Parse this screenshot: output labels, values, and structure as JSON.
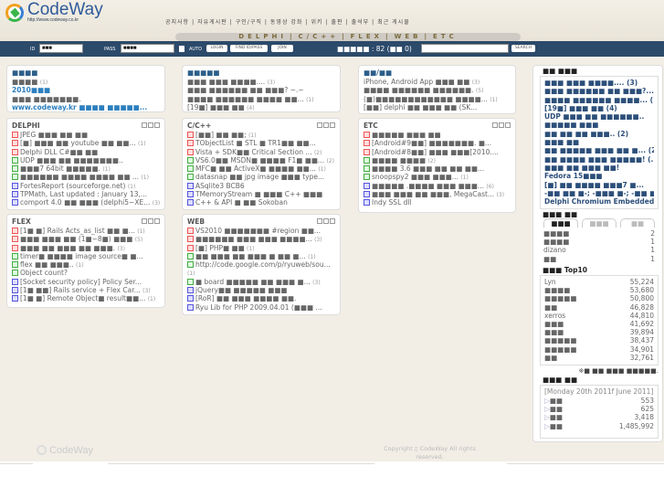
{
  "header": {
    "logo_name": "CodeWay",
    "logo_url": "http://www.codeway.co.kr",
    "menu": [
      "공지사항",
      "자유게시판",
      "구인/구직",
      "동영상 강좌",
      "위키",
      "출판",
      "출석부",
      "최근 게시물"
    ],
    "categories": [
      "DELPHI",
      "C/C++",
      "FLEX",
      "WEB",
      "ETC"
    ]
  },
  "login": {
    "id_label": "ID",
    "id_value": "■■■",
    "pass_label": "PASS",
    "pass_value": "■■■■",
    "auto_label": "AUTO",
    "login_btn": "LOGIN",
    "find_btn": "FIND ID/PASS",
    "join_btn": "JOIN",
    "online_text": "■■■■■ : 82 (■■ 0)",
    "search_btn": "SEARCH",
    "search_value": ""
  },
  "panels": {
    "notice": {
      "title": "■■■■",
      "rows": [
        {
          "t": "■■■■",
          "c": "(1)"
        },
        {
          "t": "2010■■■",
          "c": "",
          "link": true
        },
        {
          "t": "■■■ ■■■■■■■.",
          "c": ""
        },
        {
          "t": "www.codeway.kr ■■■■ ■■■■■...",
          "c": "",
          "link": true
        }
      ]
    },
    "free": {
      "title": "■■■■■",
      "rows": [
        {
          "t": "■■■ ■■■ ■■■■....",
          "c": "(3)"
        },
        {
          "t": "■■■ ■■■■■■ ■■ ■■■? ~.~",
          "c": ""
        },
        {
          "t": "■■■■ ■■■■■■ ■■■■ ■■...",
          "c": "(1)"
        },
        {
          "t": "[19■] ■■■ ■■",
          "c": "(4)"
        }
      ]
    },
    "jobs": {
      "title": "■■/■■",
      "rows": [
        {
          "t": "iPhone, Android App ■■■ ■■",
          "c": "(3)"
        },
        {
          "t": "■■■■ ■■■■■■ ■■■■■■.",
          "c": "(5)"
        },
        {
          "t": "(■)■■■■■■■■■■■■ ■■■■...",
          "c": "(1)"
        },
        {
          "t": "[■■] delphi ■■ ■■■ ■■ (SK...",
          "c": ""
        }
      ]
    },
    "delphi": {
      "title": "DELPHI",
      "rows": [
        {
          "i": "r",
          "t": "JPEG ■■■ ■■ ■■",
          "c": ""
        },
        {
          "i": "r",
          "t": "[■] ■■■ ■■ youtube ■■ ■■...",
          "c": "(1)"
        },
        {
          "i": "r",
          "t": "Delphi DLL C#■■ ■■",
          "c": ""
        },
        {
          "i": "g",
          "t": "UDP ■■■ ■■ ■■■■■■■..",
          "c": ""
        },
        {
          "i": "g",
          "t": "■■■7 64bit ■■■■■.",
          "c": "(1)"
        },
        {
          "i": "g",
          "t": "■■■■■■ ■■■■ ■■■■ ■■ ...",
          "c": "(1)"
        },
        {
          "i": "b",
          "t": "FortesReport (sourceforge.net)",
          "c": "(1)"
        },
        {
          "i": "b",
          "t": "TPMath, Last updated : January 13,...",
          "c": ""
        },
        {
          "i": "b",
          "t": "comport 4.0 ■■ ■■■ (delphi5~XE...",
          "c": "(3)"
        }
      ]
    },
    "cpp": {
      "title": "C/C++",
      "rows": [
        {
          "i": "r",
          "t": "[■■] ■■ ■■;",
          "c": "(1)"
        },
        {
          "i": "r",
          "t": "TObjectList ■ STL ■ TR1■■ ■■...",
          "c": ""
        },
        {
          "i": "r",
          "t": "Vista + SDK■■ Critical Section ...",
          "c": "(2)"
        },
        {
          "i": "g",
          "t": "VS6.0■■ MSDN■ ■■■■ F1■ ■■...",
          "c": "(2)"
        },
        {
          "i": "g",
          "t": "MFC■ ■■ ActiveX■ ■■■■ ■■...",
          "c": "(1)"
        },
        {
          "i": "g",
          "t": "datasnap ■■ jpg image ■■■ type...",
          "c": ""
        },
        {
          "i": "b",
          "t": "ASqlite3 BCB6",
          "c": ""
        },
        {
          "i": "b",
          "t": "TMemoryStream ■ ■■■ C++ ■■■",
          "c": ""
        },
        {
          "i": "b",
          "t": "C++ & API ■ ■■ Sokoban",
          "c": ""
        }
      ]
    },
    "etc": {
      "title": "ETC",
      "rows": [
        {
          "i": "r",
          "t": "■■■■■ ■■■ ■■",
          "c": ""
        },
        {
          "i": "r",
          "t": "[Android#9■■] ■■■■■■■. ■...",
          "c": ""
        },
        {
          "i": "r",
          "t": "[Android#8■■] ■■■ ■■■[2010....",
          "c": ""
        },
        {
          "i": "g",
          "t": "■■■■ ■■■■",
          "c": "(2)"
        },
        {
          "i": "g",
          "t": "■■■■ 3.6 ■■■ ■■ ■■ ■■...",
          "c": ""
        },
        {
          "i": "g",
          "t": "snoopspy2 ■■■ ■■■...",
          "c": "(1)"
        },
        {
          "i": "b",
          "t": "■■■■■ .■■■■ ■■■ ■■■...",
          "c": "(6)"
        },
        {
          "i": "b",
          "t": "■■■ ■■■ ■■ ■■■, MegaCast...",
          "c": "(3)"
        },
        {
          "i": "b",
          "t": "Indy SSL dll",
          "c": ""
        }
      ]
    },
    "flex": {
      "title": "FLEX",
      "rows": [
        {
          "i": "r",
          "t": "[1■ ■] Rails Acts_as_list ■■ ■...",
          "c": "(1)"
        },
        {
          "i": "r",
          "t": "■■■ ■■■ ■■ (1■~8■) ■■■",
          "c": "(5)"
        },
        {
          "i": "r",
          "t": "■■■ ■■ ■■■ ■■ ■■■.",
          "c": "(3)"
        },
        {
          "i": "g",
          "t": "timer■ ■■■■ image source■ ■...",
          "c": ""
        },
        {
          "i": "g",
          "t": "flex ■■ ■■■..",
          "c": "(1)"
        },
        {
          "i": "g",
          "t": "Object count?",
          "c": ""
        },
        {
          "i": "b",
          "t": "[Socket security policy] Policy Ser...",
          "c": ""
        },
        {
          "i": "b",
          "t": "[1■ ■■] Rails service + Flex Car...",
          "c": "(3)"
        },
        {
          "i": "b",
          "t": "[1■ ■] Remote Object■ result■■...",
          "c": "(1)"
        }
      ]
    },
    "web": {
      "title": "WEB",
      "rows": [
        {
          "i": "r",
          "t": "VS2010 ■■■■■■■ #region ■■...",
          "c": ""
        },
        {
          "i": "r",
          "t": "■■■■■■ ■■■ ■■■ ■■■■...",
          "c": "(3)"
        },
        {
          "i": "r",
          "t": "[■] PHP■ ■■",
          "c": "(1)"
        },
        {
          "i": "g",
          "t": "■■ ■■■ ■■ ■■■ ■ ■■ ■...",
          "c": "(1)"
        },
        {
          "i": "g",
          "t": "http://code.google.com/p/ryuweb/sou...",
          "c": ""
        },
        {
          "t": "",
          "c": "(1)"
        },
        {
          "i": "g",
          "t": "■ board ■■■■■ ■■ ■■■ ■...",
          "c": "(3)"
        },
        {
          "i": "b",
          "t": "jQuery■■ ■■■■■ ■■■",
          "c": ""
        },
        {
          "i": "b",
          "t": "[RoR] ■■ ■■■ ■■■■ ■■.",
          "c": ""
        },
        {
          "i": "b",
          "t": "Ryu Lib for PHP 2009.04.01 (■■■ ...",
          "c": ""
        }
      ]
    }
  },
  "sidebar": {
    "recent_title": "■■ ■■■",
    "recent": [
      "■■■ ■■■ ■■■■.... (3)",
      "■■■ ■■■■■■ ■■ ■■■?...",
      "■■■■ ■■■■■■ ■■■■... (1)",
      "[19■] ■■■ ■■ (4)",
      "UDP ■■■ ■■ ■■■■■■..",
      "■■■■■ ■■■",
      "■■ ■■ ■■ ■■■.. (2)",
      "■■■ ■■",
      "■■ ■■■■■ ■■■ ■■ ■... (2)",
      "■■ ■■■■ ■■■ ■■■■■! (...",
      "■■■ ■■ ■■■ ■■!",
      "Fedora 15■■■",
      "[■] ■■ ■■■■ ■■■7 ■...",
      "-■■ ■■ ■-; -■■■ ■-; -■■ ■..",
      "Delphi Chromium Embedded"
    ],
    "members_title": "■■■ ■■",
    "tabs": [
      "■■■",
      "■■■",
      "■■"
    ],
    "members": [
      {
        "k": "■■■■",
        "v": "2"
      },
      {
        "k": "■■■■",
        "v": "1"
      },
      {
        "k": "dizano",
        "v": "1"
      },
      {
        "k": "■■",
        "v": "1"
      }
    ],
    "top_title": "■■■ Top10",
    "top": [
      {
        "k": "Lyn",
        "v": "55,224"
      },
      {
        "k": "■■■■",
        "v": "53,680"
      },
      {
        "k": "■■■■■",
        "v": "50,800"
      },
      {
        "k": "■■",
        "v": "46,828"
      },
      {
        "k": "xerros",
        "v": "44,810"
      },
      {
        "k": "■■■",
        "v": "41,692"
      },
      {
        "k": "■■■",
        "v": "39,894"
      },
      {
        "k": "■■■■■",
        "v": "38,437"
      },
      {
        "k": "■■■■■",
        "v": "34,901"
      },
      {
        "k": "■■",
        "v": "32,761"
      }
    ],
    "top_note": "※■ ■■ ■■■ ■■■■■.",
    "stats_title": "■■■ ■■",
    "stats_date": "[Monday 20th 2011f June 2011]",
    "stats": [
      {
        "k": "■■",
        "v": "553"
      },
      {
        "k": "■■",
        "v": "625"
      },
      {
        "k": "■■",
        "v": "3,418"
      },
      {
        "k": "■■",
        "v": "1,485,992"
      }
    ]
  },
  "footer": {
    "logo": "CodeWay",
    "copyright": "Copyright ▯ CodeWay All rights reserved."
  }
}
